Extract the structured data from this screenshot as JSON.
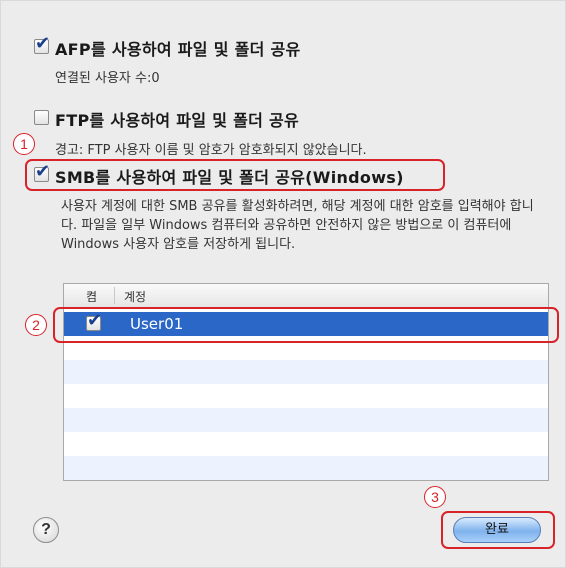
{
  "afp": {
    "label": "AFP를 사용하여 파일 및 폴더 공유",
    "checked": true,
    "connected_users": "연결된 사용자 수:0"
  },
  "ftp": {
    "label": "FTP를 사용하여 파일 및 폴더 공유",
    "checked": false,
    "warning": "경고: FTP 사용자 이름 및 암호가 암호화되지 않았습니다."
  },
  "smb": {
    "label": "SMB를 사용하여 파일 및 폴더 공유(Windows)",
    "checked": true,
    "description": "사용자 계정에 대한 SMB 공유를 활성화하려면, 해당 계정에 대한 암호를 입력해야 합니다. 파일을 일부 Windows 컴퓨터와 공유하면 안전하지 않은 방법으로 이 컴퓨터에 Windows 사용자 암호를 저장하게 됩니다."
  },
  "accounts": {
    "header_on": "켬",
    "header_account": "계정",
    "rows": [
      {
        "user": "User01",
        "checked": true,
        "selected": true
      }
    ]
  },
  "buttons": {
    "help": "?",
    "done": "완료"
  },
  "callouts": [
    "1",
    "2",
    "3"
  ],
  "colors": {
    "accent": "#d8232a",
    "selection": "#2a67c6",
    "checkmark": "#1b3f8f"
  }
}
